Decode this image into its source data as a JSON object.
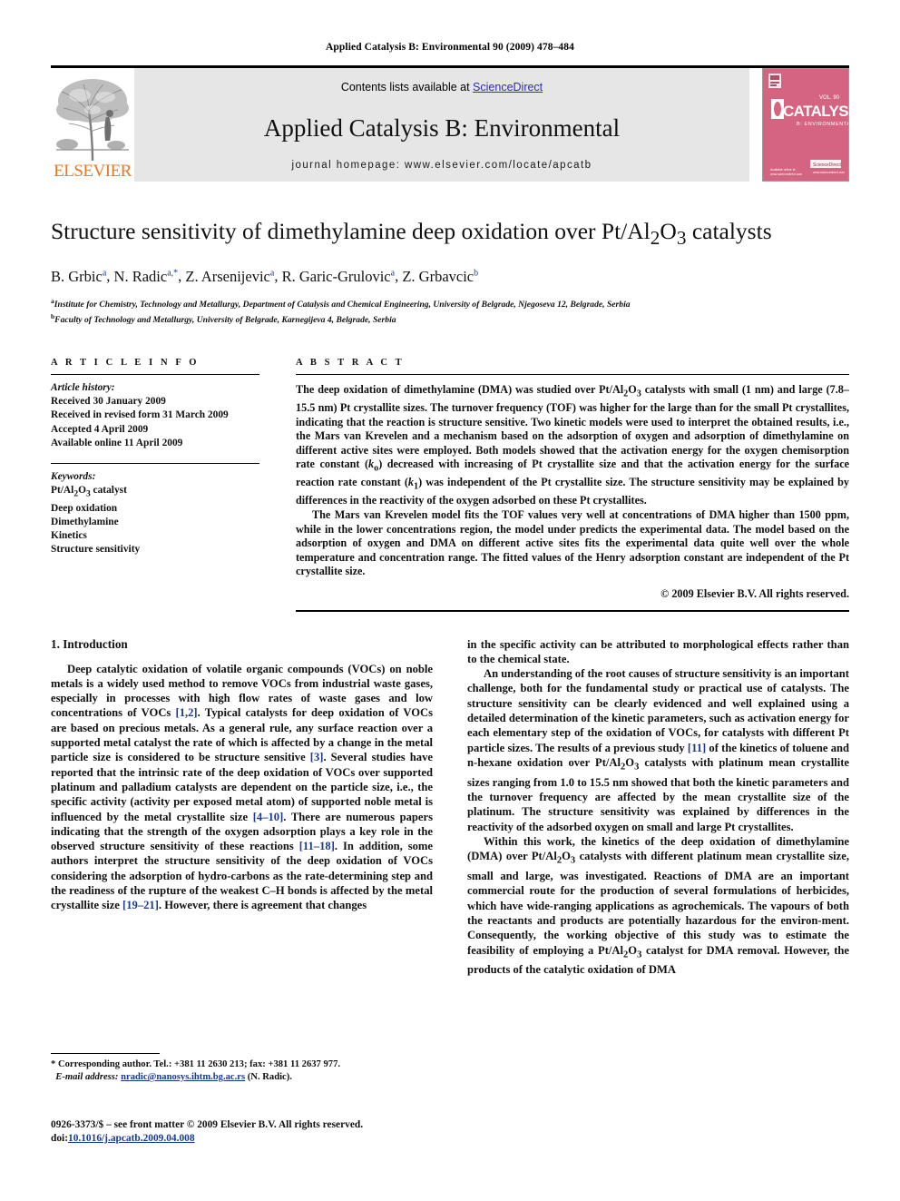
{
  "running_head": "Applied Catalysis B: Environmental 90 (2009) 478–484",
  "masthead": {
    "contents_prefix": "Contents lists available at ",
    "sciencedirect": "ScienceDirect",
    "journal_title": "Applied Catalysis B: Environmental",
    "homepage": "journal homepage: www.elsevier.com/locate/apcatb",
    "publisher": "ELSEVIER",
    "cover_title": "CATALYSIS",
    "cover_subtitle": "B: ENVIRONMENTAL",
    "cover_volume": "VOL. 90",
    "cover_color": "#d4647f",
    "accent_link_color": "#2b2bb5",
    "elsevier_orange": "#E87722"
  },
  "article": {
    "title_part1": "Structure sensitivity of dimethylamine deep oxidation over Pt/Al",
    "title_sub1": "2",
    "title_part2": "O",
    "title_sub2": "3",
    "title_part3": " catalysts",
    "authors": [
      {
        "name": "B. Grbic",
        "sup": "a"
      },
      {
        "name": "N. Radic",
        "sup": "a,*"
      },
      {
        "name": "Z. Arsenijevic",
        "sup": "a"
      },
      {
        "name": "R. Garic-Grulovic",
        "sup": "a"
      },
      {
        "name": "Z. Grbavcic",
        "sup": "b"
      }
    ],
    "affiliations": [
      {
        "sup": "a",
        "text": "Institute for Chemistry, Technology and Metallurgy, Department of Catalysis and Chemical Engineering, University of Belgrade, Njegoseva 12, Belgrade, Serbia"
      },
      {
        "sup": "b",
        "text": "Faculty of Technology and Metallurgy, University of Belgrade, Karnegijeva 4, Belgrade, Serbia"
      }
    ]
  },
  "article_info": {
    "heading": "A R T I C L E  I N F O",
    "history_label": "Article history:",
    "history": [
      "Received 30 January 2009",
      "Received in revised form 31 March 2009",
      "Accepted 4 April 2009",
      "Available online 11 April 2009"
    ],
    "keywords_label": "Keywords:",
    "keywords": [
      "Pt/Al2O3 catalyst",
      "Deep oxidation",
      "Dimethylamine",
      "Kinetics",
      "Structure sensitivity"
    ]
  },
  "abstract": {
    "heading": "A B S T R A C T",
    "paragraph1": "The deep oxidation of dimethylamine (DMA) was studied over Pt/Al2O3 catalysts with small (1 nm) and large (7.8–15.5 nm) Pt crystallite sizes. The turnover frequency (TOF) was higher for the large than for the small Pt crystallites, indicating that the reaction is structure sensitive. Two kinetic models were used to interpret the obtained results, i.e., the Mars van Krevelen and a mechanism based on the adsorption of oxygen and adsorption of dimethylamine on different active sites were employed. Both models showed that the activation energy for the oxygen chemisorption rate constant (ko) decreased with increasing of Pt crystallite size and that the activation energy for the surface reaction rate constant (k1) was independent of the Pt crystallite size. The structure sensitivity may be explained by differences in the reactivity of the oxygen adsorbed on these Pt crystallites.",
    "paragraph2": "The Mars van Krevelen model fits the TOF values very well at concentrations of DMA higher than 1500 ppm, while in the lower concentrations region, the model under predicts the experimental data. The model based on the adsorption of oxygen and DMA on different active sites fits the experimental data quite well over the whole temperature and concentration range. The fitted values of the Henry adsorption constant are independent of the Pt crystallite size.",
    "copyright": "© 2009 Elsevier B.V. All rights reserved."
  },
  "sections": {
    "intro_heading": "1. Introduction",
    "left_para1": "Deep catalytic oxidation of volatile organic compounds (VOCs) on noble metals is a widely used method to remove VOCs from industrial waste gases, especially in processes with high flow rates of waste gases and low concentrations of VOCs [1,2]. Typical catalysts for deep oxidation of VOCs are based on precious metals. As a general rule, any surface reaction over a supported metal catalyst the rate of which is affected by a change in the metal particle size is considered to be structure sensitive [3]. Several studies have reported that the intrinsic rate of the deep oxidation of VOCs over supported platinum and palladium catalysts are dependent on the particle size, i.e., the specific activity (activity per exposed metal atom) of supported noble metal is influenced by the metal crystallite size [4–10]. There are numerous papers indicating that the strength of the oxygen adsorption plays a key role in the observed structure sensitivity of these reactions [11–18]. In addition, some authors interpret the structure sensitivity of the deep oxidation of VOCs considering the adsorption of hydrocarbons as the rate-determining step and the readiness of the rupture of the weakest C–H bonds is affected by the metal crystallite size [19–21]. However, there is agreement that changes",
    "right_para1": "in the specific activity can be attributed to morphological effects rather than to the chemical state.",
    "right_para2": "An understanding of the root causes of structure sensitivity is an important challenge, both for the fundamental study or practical use of catalysts. The structure sensitivity can be clearly evidenced and well explained using a detailed determination of the kinetic parameters, such as activation energy for each elementary step of the oxidation of VOCs, for catalysts with different Pt particle sizes. The results of a previous study [11] of the kinetics of toluene and n-hexane oxidation over Pt/Al2O3 catalysts with platinum mean crystallite sizes ranging from 1.0 to 15.5 nm showed that both the kinetic parameters and the turnover frequency are affected by the mean crystallite size of the platinum. The structure sensitivity was explained by differences in the reactivity of the adsorbed oxygen on small and large Pt crystallites.",
    "right_para3": "Within this work, the kinetics of the deep oxidation of dimethylamine (DMA) over Pt/Al2O3 catalysts with different platinum mean crystallite size, small and large, was investigated. Reactions of DMA are an important commercial route for the production of several formulations of herbicides, which have wide-ranging applications as agrochemicals. The vapours of both the reactants and products are potentially hazardous for the environment. Consequently, the working objective of this study was to estimate the feasibility of employing a Pt/Al2O3 catalyst for DMA removal. However, the products of the catalytic oxidation of DMA"
  },
  "footnote": {
    "marker": "*",
    "corresponding": "Corresponding author. Tel.: +381 11 2630 213; fax: +381 11 2637 977.",
    "email_label": "E-mail address:",
    "email": "nradic@nanosys.ihtm.bg.ac.rs",
    "email_attrib": "(N. Radic)."
  },
  "imprint": {
    "issn_line": "0926-3373/$ – see front matter © 2009 Elsevier B.V. All rights reserved.",
    "doi_label": "doi:",
    "doi": "10.1016/j.apcatb.2009.04.008"
  }
}
